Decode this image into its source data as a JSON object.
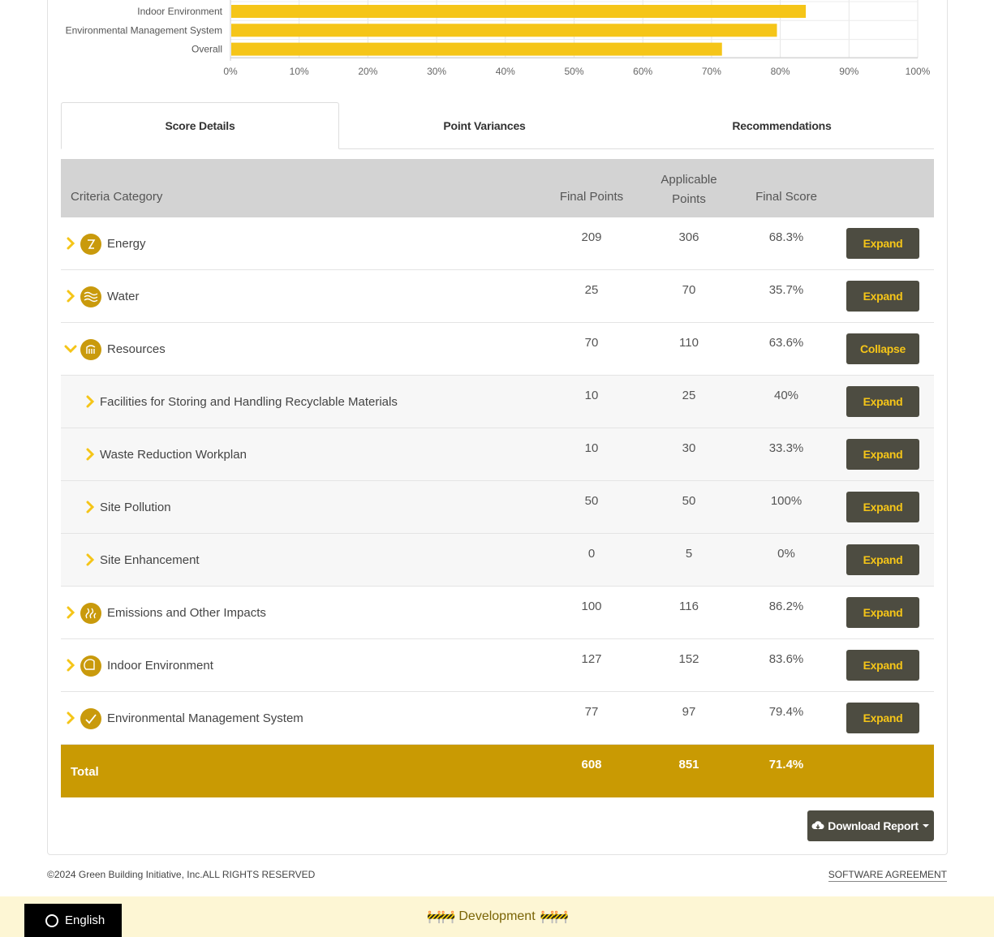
{
  "chart_data": {
    "type": "bar",
    "orientation": "horizontal",
    "categories": [
      "Indoor Environment",
      "Environmental Management System",
      "Overall"
    ],
    "values": [
      83.6,
      79.4,
      71.4
    ],
    "xlim": [
      0,
      100
    ],
    "xticks": [
      "0%",
      "10%",
      "20%",
      "30%",
      "40%",
      "50%",
      "60%",
      "70%",
      "80%",
      "90%",
      "100%"
    ],
    "grid": true,
    "color": "#f5c518"
  },
  "tabs": [
    {
      "label": "Score Details",
      "active": true
    },
    {
      "label": "Point Variances",
      "active": false
    },
    {
      "label": "Recommendations",
      "active": false
    }
  ],
  "table": {
    "headers": {
      "category": "Criteria Category",
      "final_points": "Final Points",
      "applicable_points_1": "Applicable",
      "applicable_points_2": "Points",
      "final_score": "Final Score"
    },
    "rows": [
      {
        "label": "Energy",
        "final": "209",
        "applicable": "306",
        "score": "68.3%",
        "button": "Expand",
        "icon": "energy-icon"
      },
      {
        "label": "Water",
        "final": "25",
        "applicable": "70",
        "score": "35.7%",
        "button": "Expand",
        "icon": "water-icon"
      },
      {
        "label": "Resources",
        "final": "70",
        "applicable": "110",
        "score": "63.6%",
        "button": "Collapse",
        "icon": "resources-icon"
      },
      {
        "label": "Facilities for Storing and Handling Recyclable Materials",
        "final": "10",
        "applicable": "25",
        "score": "40%",
        "button": "Expand"
      },
      {
        "label": "Waste Reduction Workplan",
        "final": "10",
        "applicable": "30",
        "score": "33.3%",
        "button": "Expand"
      },
      {
        "label": "Site Pollution",
        "final": "50",
        "applicable": "50",
        "score": "100%",
        "button": "Expand"
      },
      {
        "label": "Site Enhancement",
        "final": "0",
        "applicable": "5",
        "score": "0%",
        "button": "Expand"
      },
      {
        "label": "Emissions and Other Impacts",
        "final": "100",
        "applicable": "116",
        "score": "86.2%",
        "button": "Expand",
        "icon": "emissions-icon"
      },
      {
        "label": "Indoor Environment",
        "final": "127",
        "applicable": "152",
        "score": "83.6%",
        "button": "Expand",
        "icon": "indoor-environment-icon"
      },
      {
        "label": "Environmental Management System",
        "final": "77",
        "applicable": "97",
        "score": "79.4%",
        "button": "Expand",
        "icon": "management-system-icon"
      }
    ],
    "total": {
      "label": "Total",
      "final": "608",
      "applicable": "851",
      "score": "71.4%"
    }
  },
  "download_label": "Download Report",
  "footer": {
    "copyright": "©2024 Green Building Initiative, Inc.ALL RIGHTS RESERVED",
    "software_agreement": "SOFTWARE AGREEMENT"
  },
  "dev_banner": {
    "label": "Development",
    "barrier": "🚧🚧"
  },
  "language": "English",
  "colors": {
    "accent": "#c99a03",
    "button_bg": "#4d4c41",
    "button_text": "#f5c518",
    "bar": "#f5c518"
  }
}
